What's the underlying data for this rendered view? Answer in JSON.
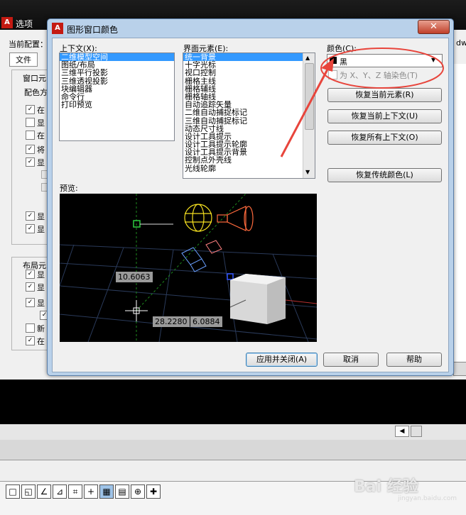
{
  "app": {
    "logo_letter": "A",
    "title": "选项",
    "current_config_label": "当前配置：",
    "right_edge_text": "dw",
    "file_tab": "文件",
    "window_group_label": "窗口元",
    "color_group_label": "配色方",
    "layout_group_label": "布局元",
    "window_items": [
      "在",
      "显",
      "在",
      "将",
      "显",
      "",
      "",
      "显",
      "显"
    ],
    "layout_items": [
      "显",
      "显",
      "显",
      "",
      "新",
      "在"
    ]
  },
  "dialog": {
    "title": "图形窗口颜色",
    "close_label": "✕",
    "context_label": "上下文(X):",
    "context_items": [
      "二维模型空间",
      "图纸/布局",
      "三维平行投影",
      "三维透视投影",
      "块编辑器",
      "命令行",
      "打印预览"
    ],
    "context_selected": 0,
    "interface_label": "界面元素(E):",
    "interface_items": [
      "统一背景",
      "十字光标",
      "视口控制",
      "栅格主线",
      "栅格辅线",
      "栅格轴线",
      "自动追踪矢量",
      "二维自动捕捉标记",
      "三维自动捕捉标记",
      "动态尺寸线",
      "设计工具提示",
      "设计工具提示轮廓",
      "设计工具提示背景",
      "控制点外壳线",
      "光线轮廓"
    ],
    "interface_selected": 0,
    "color_label": "颜色(C):",
    "color_value": "黑",
    "color_swatch": "#000000",
    "tint_label": "为 X、Y、Z 轴染色(T)",
    "restore_element": "恢复当前元素(R)",
    "restore_context": "恢复当前上下文(U)",
    "restore_all": "恢复所有上下文(O)",
    "restore_classic": "恢复传统颜色(L)",
    "preview_label": "预览:",
    "preview_dims": [
      "10.6063",
      "28.2280",
      "6.0884"
    ],
    "apply_close": "应用并关闭(A)",
    "cancel": "取消",
    "help": "帮助"
  },
  "watermark": {
    "text": "Bai 经验",
    "sub": "jingyan.baidu.com"
  },
  "colors": {
    "annotation": "#e8453c",
    "selection": "#3399ff"
  }
}
